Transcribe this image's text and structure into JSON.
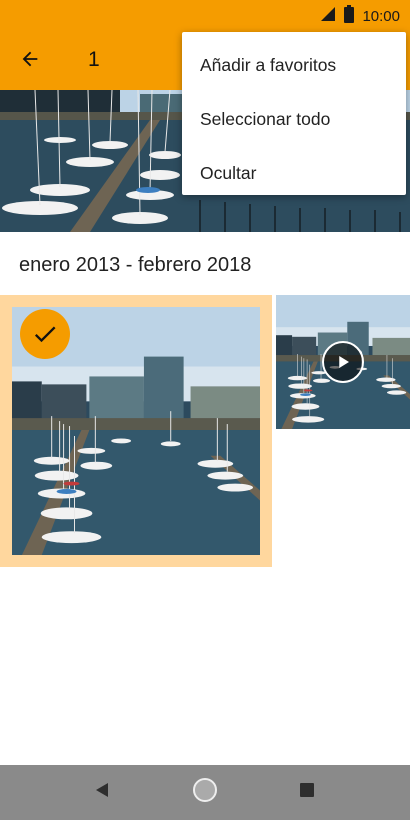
{
  "status_bar": {
    "time": "10:00",
    "signal_icon": "signal-icon",
    "battery_icon": "battery-icon"
  },
  "app_bar": {
    "back_icon": "arrow-left-icon",
    "selected_count": "1"
  },
  "overflow_menu": {
    "items": [
      {
        "label": "Añadir a favoritos"
      },
      {
        "label": "Seleccionar todo"
      },
      {
        "label": "Ocultar"
      }
    ]
  },
  "gallery": {
    "date_range": "enero 2013 - febrero 2018",
    "items": [
      {
        "kind": "photo",
        "selected": true,
        "badge_icon": "checkmark-icon"
      },
      {
        "kind": "video",
        "selected": false,
        "badge_icon": "play-icon"
      }
    ]
  },
  "nav_bar": {
    "back_icon": "nav-back-icon",
    "home_icon": "nav-home-icon",
    "recents_icon": "nav-recents-icon"
  },
  "colors": {
    "accent": "#f59c00",
    "selection_border": "#ffd79e",
    "nav_bar": "#8a8a8a"
  }
}
